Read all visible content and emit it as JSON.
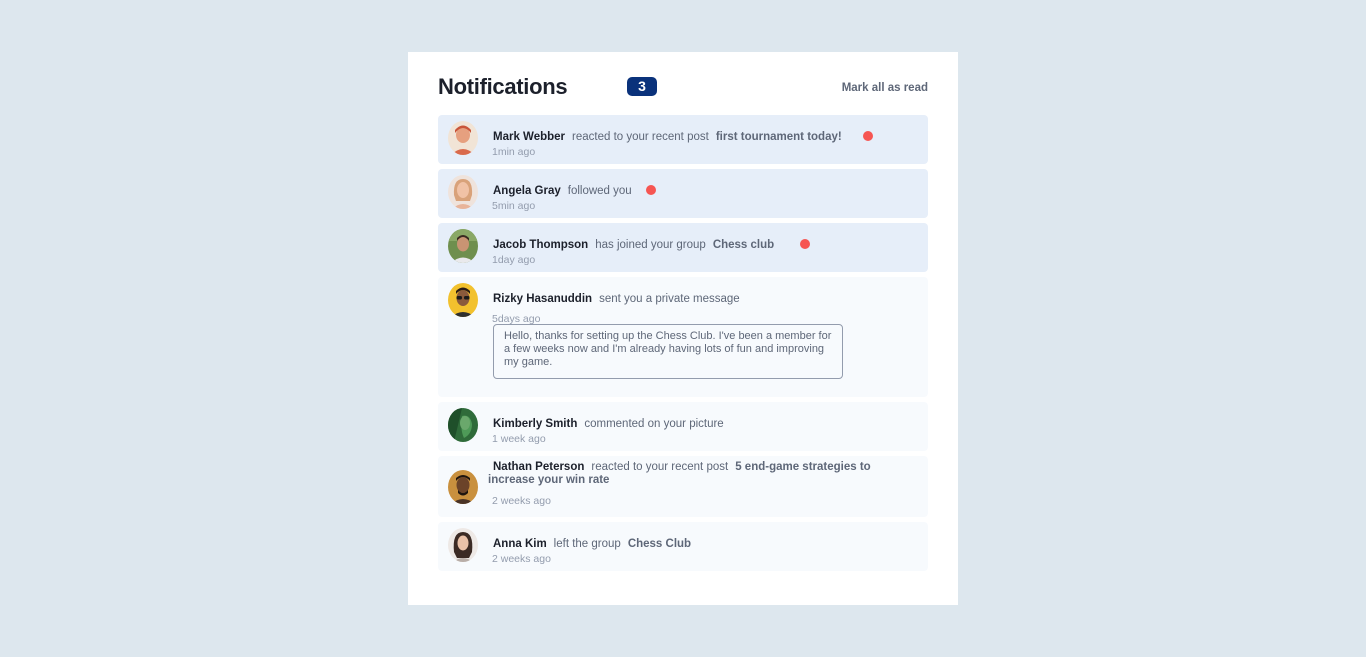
{
  "header": {
    "title": "Notifications",
    "unread_count": "3",
    "mark_all_label": "Mark all as read"
  },
  "notifications": [
    {
      "user": "Mark Webber",
      "action": "reacted to your recent post",
      "target": "first tournament today!",
      "time": "1min ago",
      "unread": true
    },
    {
      "user": "Angela Gray",
      "action": "followed you",
      "target": "",
      "time": "5min ago",
      "unread": true
    },
    {
      "user": "Jacob Thompson",
      "action": "has joined your group",
      "target": "Chess club",
      "time": "1day ago",
      "unread": true
    },
    {
      "user": "Rizky Hasanuddin",
      "action": "sent you a private message",
      "target": "",
      "time": "5days ago",
      "unread": false,
      "message": "Hello, thanks for setting up the Chess Club. I've been a member for a few weeks now and I'm already having lots of fun and improving my game."
    },
    {
      "user": "Kimberly Smith",
      "action": "commented on your picture",
      "target": "",
      "time": "1 week ago",
      "unread": false
    },
    {
      "user": "Nathan Peterson",
      "action": "reacted to your recent post",
      "target": "5 end-game strategies to increase your win rate",
      "time": "2 weeks ago",
      "unread": false
    },
    {
      "user": "Anna Kim",
      "action": "left the group",
      "target": "Chess Club",
      "time": "2 weeks ago",
      "unread": false
    }
  ],
  "colors": {
    "background": "#dde7ee",
    "card": "#ffffff",
    "unread_bg": "#e6eef9",
    "read_bg": "#f7fafd",
    "badge": "#0a327b",
    "dot": "#f65552",
    "heading_text": "#1c202b",
    "body_text": "#5e6778",
    "muted_text": "#939cad"
  },
  "icons": {
    "unread_dot": "red-dot-icon"
  }
}
